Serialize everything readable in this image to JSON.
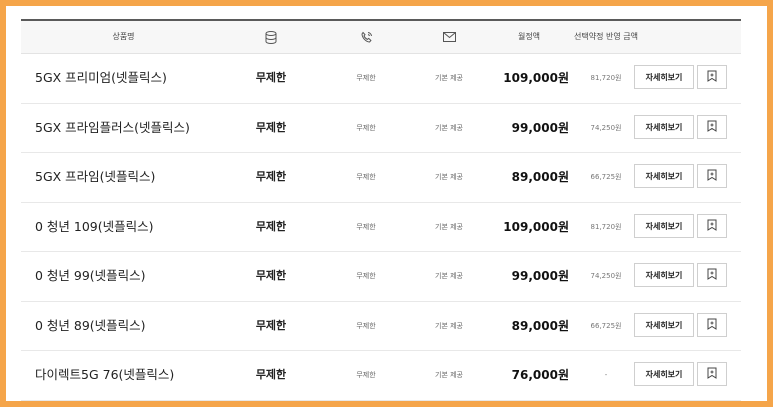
{
  "header": {
    "plan_name": "상품명",
    "data_icon": "database-icon",
    "voice_icon": "phone-call-icon",
    "sms_icon": "envelope-icon",
    "monthly_fee": "월정액",
    "selective_discount": "선택약정 반영 금액"
  },
  "action_label": "자세히보기",
  "bookmark_icon": "bookmark-icon",
  "plans": [
    {
      "name": "5GX 프리미엄(넷플릭스)",
      "data": "무제한",
      "voice": "무제한",
      "sms": "기본 제공",
      "price": "109,000원",
      "discount": "81,720원"
    },
    {
      "name": "5GX 프라임플러스(넷플릭스)",
      "data": "무제한",
      "voice": "무제한",
      "sms": "기본 제공",
      "price": "99,000원",
      "discount": "74,250원"
    },
    {
      "name": "5GX 프라임(넷플릭스)",
      "data": "무제한",
      "voice": "무제한",
      "sms": "기본 제공",
      "price": "89,000원",
      "discount": "66,725원"
    },
    {
      "name": "0 청년 109(넷플릭스)",
      "data": "무제한",
      "voice": "무제한",
      "sms": "기본 제공",
      "price": "109,000원",
      "discount": "81,720원"
    },
    {
      "name": "0 청년 99(넷플릭스)",
      "data": "무제한",
      "voice": "무제한",
      "sms": "기본 제공",
      "price": "99,000원",
      "discount": "74,250원"
    },
    {
      "name": "0 청년 89(넷플릭스)",
      "data": "무제한",
      "voice": "무제한",
      "sms": "기본 제공",
      "price": "89,000원",
      "discount": "66,725원"
    },
    {
      "name": "다이렉트5G 76(넷플릭스)",
      "data": "무제한",
      "voice": "무제한",
      "sms": "기본 제공",
      "price": "76,000원",
      "discount": "-"
    }
  ]
}
